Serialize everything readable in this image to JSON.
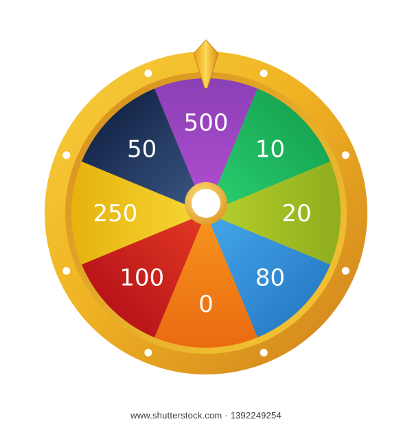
{
  "wheel": {
    "segments": [
      {
        "label": "500",
        "color": "#8a3fb5",
        "color_light": "#b34fd3"
      },
      {
        "label": "10",
        "color": "#17a653",
        "color_light": "#2bd171"
      },
      {
        "label": "20",
        "color": "#8fae1e",
        "color_light": "#b8d02c"
      },
      {
        "label": "80",
        "color": "#2a7ec8",
        "color_light": "#45a7ea"
      },
      {
        "label": "0",
        "color": "#ea6a10",
        "color_light": "#f7951f"
      },
      {
        "label": "100",
        "color": "#b8141a",
        "color_light": "#e33a22"
      },
      {
        "label": "250",
        "color": "#e7b20d",
        "color_light": "#f6d836"
      },
      {
        "label": "50",
        "color": "#16284b",
        "color_light": "#3c5a88"
      }
    ],
    "rim_color": "#f0b323",
    "rim_dark": "#d28a1c",
    "pointer_color": "#f2b630"
  },
  "watermark": "www.shutterstock.com · 1392249254"
}
